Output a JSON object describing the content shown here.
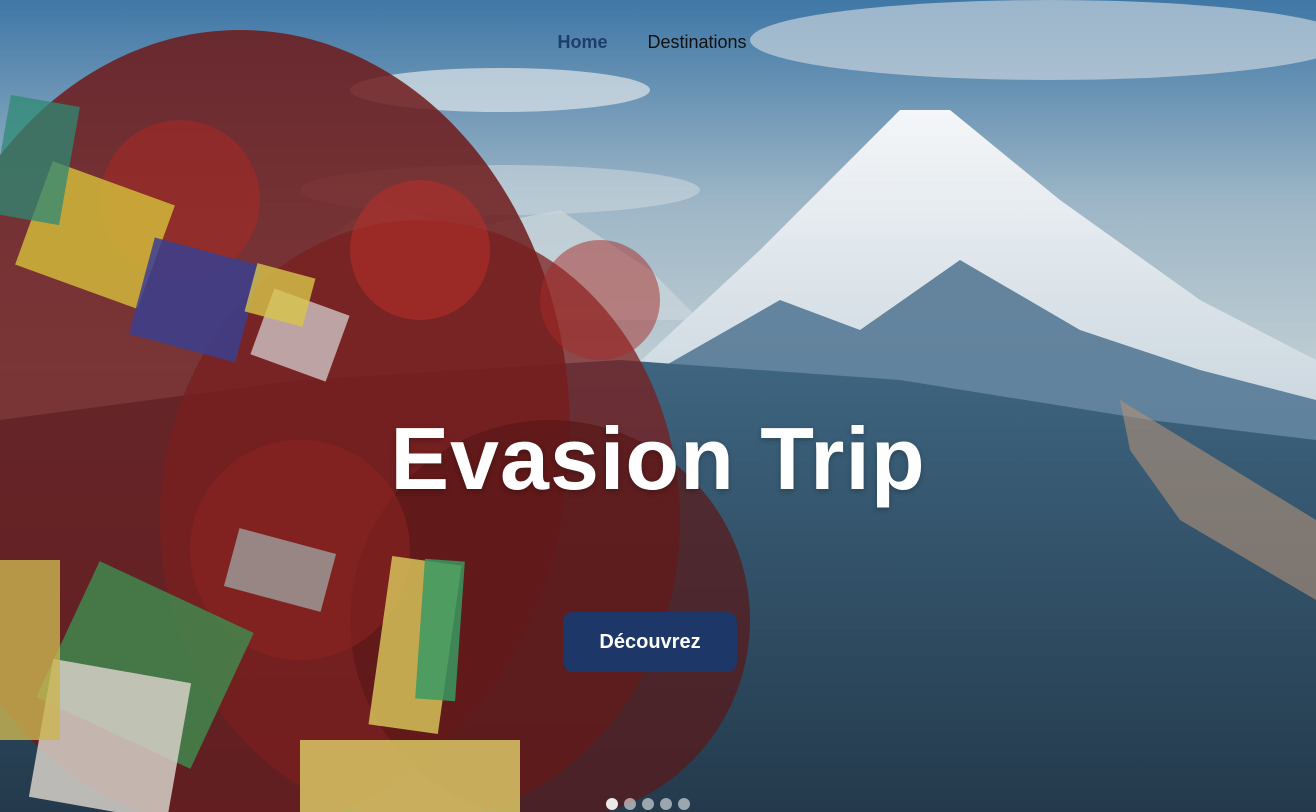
{
  "nav": {
    "items": [
      {
        "label": "Home",
        "active": true
      },
      {
        "label": "Destinations",
        "active": false
      }
    ]
  },
  "hero": {
    "title": "Evasion Trip",
    "cta_label": "Découvrez"
  },
  "carousel": {
    "slide_count": 5,
    "active_index": 0
  },
  "colors": {
    "accent": "#1c3768",
    "nav_active": "#1f3d6a"
  }
}
